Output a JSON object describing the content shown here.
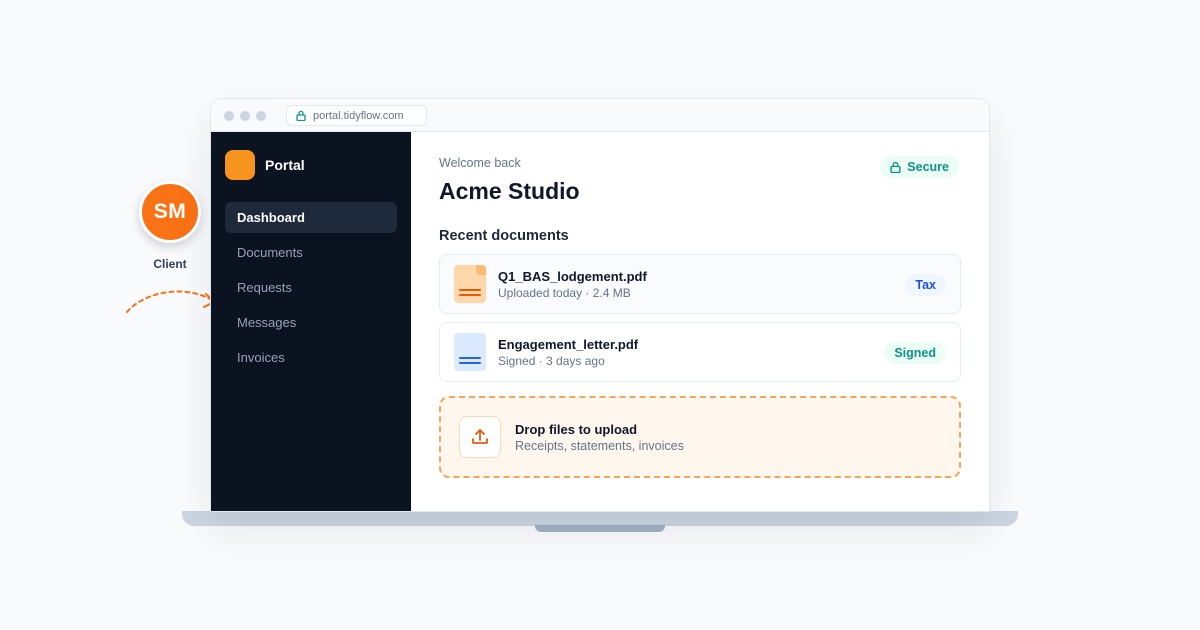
{
  "client": {
    "initials": "SM",
    "label": "Client"
  },
  "browser": {
    "url": "portal.tidyflow.com"
  },
  "sidebar": {
    "brand": "Portal",
    "items": [
      {
        "label": "Dashboard",
        "active": true
      },
      {
        "label": "Documents",
        "active": false
      },
      {
        "label": "Requests",
        "active": false
      },
      {
        "label": "Messages",
        "active": false
      },
      {
        "label": "Invoices",
        "active": false
      }
    ]
  },
  "main": {
    "welcome": "Welcome back",
    "title": "Acme Studio",
    "secure_label": "Secure",
    "section_title": "Recent documents",
    "documents": [
      {
        "name": "Q1_BAS_lodgement.pdf",
        "meta": "Uploaded today · 2.4 MB",
        "tag": "Tax"
      },
      {
        "name": "Engagement_letter.pdf",
        "meta": "Signed · 3 days ago",
        "tag": "Signed"
      }
    ],
    "dropzone": {
      "title": "Drop files to upload",
      "subtitle": "Receipts, statements, invoices"
    }
  },
  "colors": {
    "accent": "#f97316",
    "sidebar_bg": "#0b1220",
    "secure_green": "#0d9488",
    "tag_blue": "#1d4ed8"
  },
  "icons": {
    "url_lock": "lock-icon",
    "secure": "lock-icon",
    "upload": "upload-icon",
    "doc_tax": "file-icon",
    "doc_signed": "file-icon"
  }
}
